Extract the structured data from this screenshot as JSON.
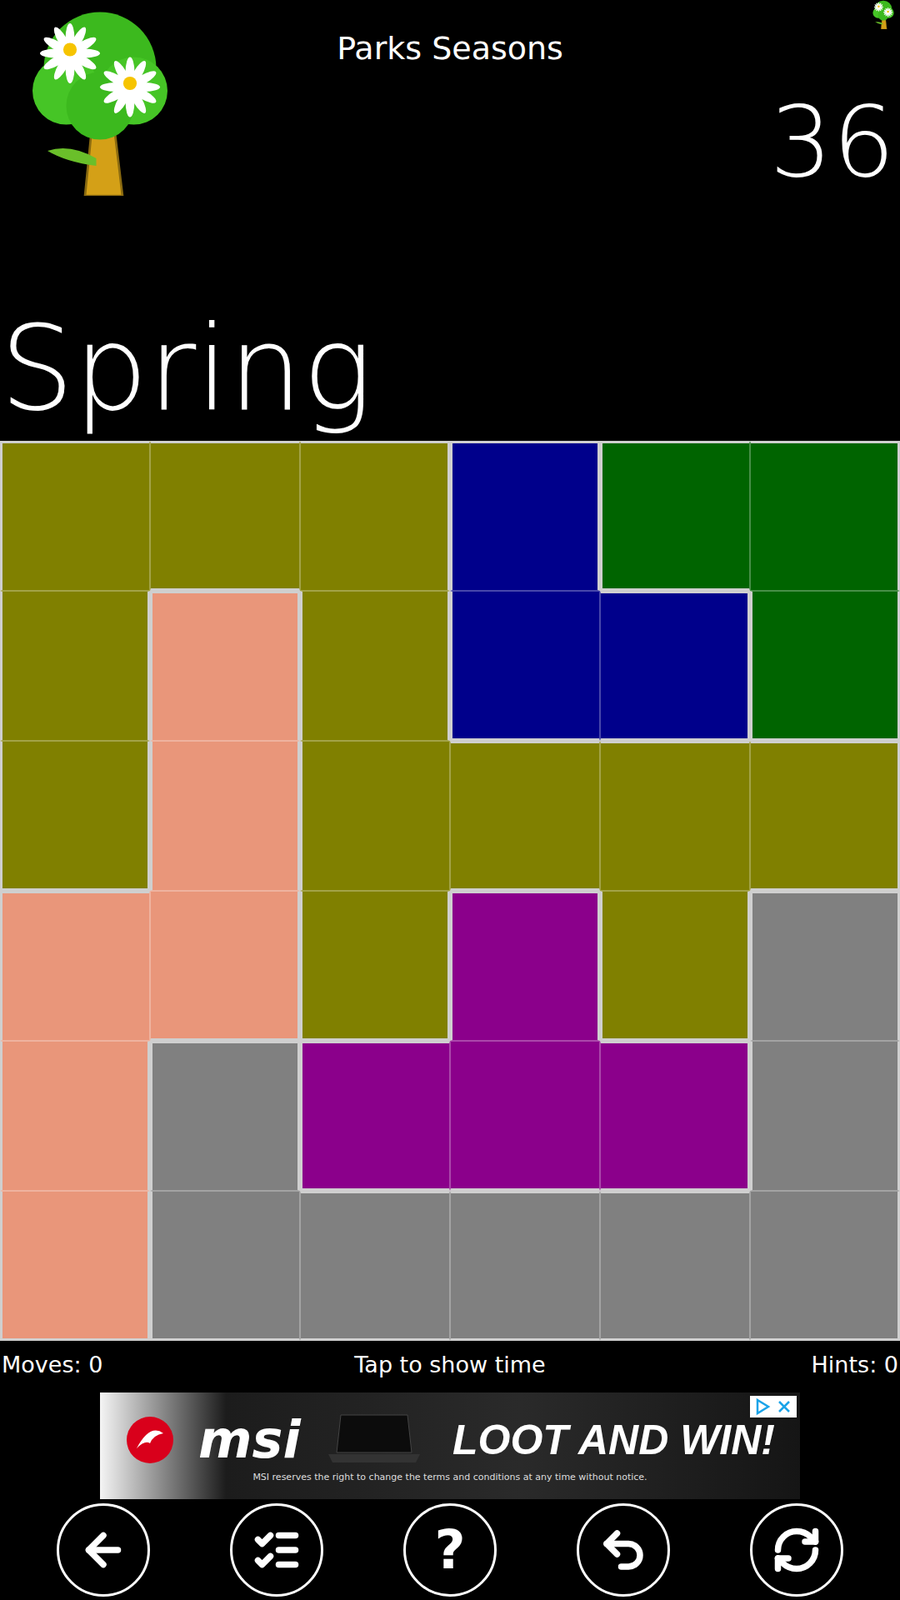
{
  "header": {
    "title": "Parks Seasons",
    "level": "36"
  },
  "season": "Spring",
  "board": {
    "regions": [
      {
        "color": "#808000"
      },
      {
        "color": "#00008b"
      },
      {
        "color": "#006400"
      },
      {
        "color": "#e9967a"
      },
      {
        "color": "#8b008b"
      },
      {
        "color": "#808080"
      }
    ],
    "cells": [
      [
        0,
        0,
        0,
        1,
        2,
        2
      ],
      [
        0,
        3,
        0,
        1,
        1,
        2
      ],
      [
        0,
        3,
        0,
        0,
        0,
        0
      ],
      [
        3,
        3,
        0,
        4,
        0,
        5
      ],
      [
        3,
        5,
        4,
        4,
        4,
        5
      ],
      [
        3,
        5,
        5,
        5,
        5,
        5
      ]
    ]
  },
  "status_bar": {
    "moves": "Moves: 0",
    "timer": "Tap to show time",
    "hints": "Hints: 0"
  },
  "ad": {
    "brand": "msi",
    "headline": "LOOT AND WIN!",
    "disclaimer": "MSI reserves the right to change the terms and conditions at any time without notice."
  },
  "toolbar": [
    {
      "name": "back-button",
      "kind": "back"
    },
    {
      "name": "levels-button",
      "kind": "list"
    },
    {
      "name": "help-button",
      "kind": "text",
      "label": "?"
    },
    {
      "name": "undo-button",
      "kind": "undo"
    },
    {
      "name": "restart-button",
      "kind": "restart"
    }
  ]
}
